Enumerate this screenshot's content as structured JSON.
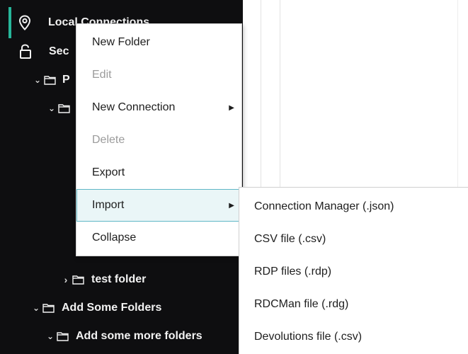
{
  "colors": {
    "sidebar_bg": "#0e0e10",
    "accent": "#27b69a",
    "menu_active_bg": "#eaf6f7",
    "menu_active_border": "#5fb7c6",
    "disabled_text": "#9b9b9b"
  },
  "tree": {
    "local_connections": "Local Connections",
    "secure_partial": "Sec",
    "folder_p_partial": "P",
    "test_folder": "test folder",
    "add_some_folders": "Add Some Folders",
    "add_some_more_folders": "Add some more folders"
  },
  "context_menu": {
    "items": [
      {
        "label": "New Folder",
        "enabled": true,
        "submenu": false
      },
      {
        "label": "Edit",
        "enabled": false,
        "submenu": false
      },
      {
        "label": "New Connection",
        "enabled": true,
        "submenu": true
      },
      {
        "label": "Delete",
        "enabled": false,
        "submenu": false
      },
      {
        "label": "Export",
        "enabled": true,
        "submenu": false
      },
      {
        "label": "Import",
        "enabled": true,
        "submenu": true,
        "highlighted": true
      },
      {
        "label": "Collapse",
        "enabled": true,
        "submenu": false
      }
    ]
  },
  "import_submenu": {
    "items": [
      "Connection Manager (.json)",
      "CSV file (.csv)",
      "RDP files (.rdp)",
      "RDCMan file (.rdg)",
      "Devolutions file (.csv)"
    ]
  },
  "icons": {
    "location": "map-pin-icon",
    "unlock": "unlock-icon",
    "folder": "folder-icon",
    "chevron_down": "chevron-down-icon",
    "chevron_right": "chevron-right-icon",
    "submenu_arrow": "submenu-arrow-icon"
  }
}
